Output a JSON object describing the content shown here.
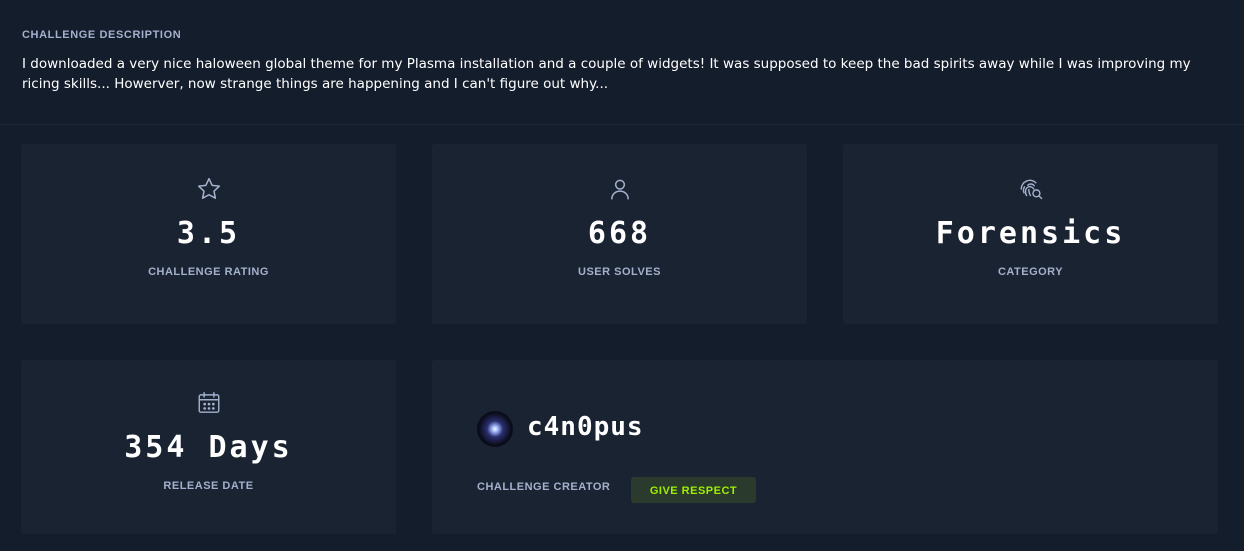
{
  "description": {
    "heading": "CHALLENGE DESCRIPTION",
    "text": "I downloaded a very nice haloween global theme for my Plasma installation and a couple of widgets! It was supposed to keep the bad spirits away while I was improving my ricing skills... Howerver, now strange things are happening and I can't figure out why..."
  },
  "stats": {
    "rating": {
      "icon": "star-icon",
      "value": "3.5",
      "label": "CHALLENGE RATING"
    },
    "solves": {
      "icon": "user-icon",
      "value": "668",
      "label": "USER SOLVES"
    },
    "category": {
      "icon": "fingerprint-search-icon",
      "value": "Forensics",
      "label": "CATEGORY"
    },
    "release": {
      "icon": "calendar-icon",
      "value": "354 Days",
      "label": "RELEASE DATE"
    }
  },
  "creator": {
    "name": "c4n0pus",
    "label": "CHALLENGE CREATOR",
    "respect_button": "GIVE RESPECT"
  },
  "colors": {
    "background": "#141d2b",
    "card": "#1a2332",
    "label": "#a4b1cd",
    "accent": "#9fef00"
  }
}
